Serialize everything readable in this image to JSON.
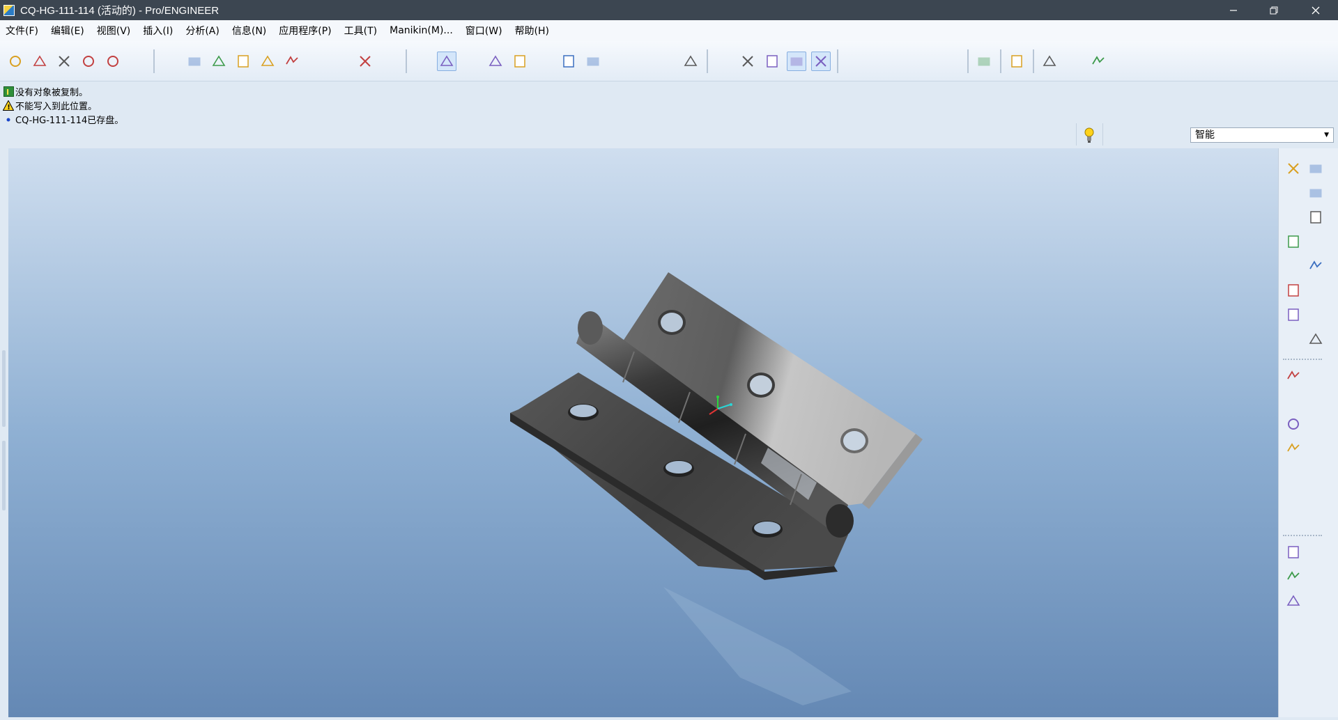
{
  "window": {
    "title": "CQ-HG-111-114 (活动的) - Pro/ENGINEER",
    "controls": [
      "minimize-icon",
      "restore-icon",
      "close-icon"
    ]
  },
  "menu": {
    "items": [
      {
        "label": "文件(F)"
      },
      {
        "label": "编辑(E)"
      },
      {
        "label": "视图(V)"
      },
      {
        "label": "插入(I)"
      },
      {
        "label": "分析(A)"
      },
      {
        "label": "信息(N)"
      },
      {
        "label": "应用程序(P)"
      },
      {
        "label": "工具(T)"
      },
      {
        "label": "Manikin(M)..."
      },
      {
        "label": "窗口(W)"
      },
      {
        "label": "帮助(H)"
      }
    ]
  },
  "toolbar": {
    "groups": [
      [
        "new-file-icon",
        "open-folder-icon",
        "save-icon",
        "print-icon",
        "send-email-icon",
        "send-link-icon"
      ],
      [
        "undo-icon",
        "redo-icon",
        "cut-icon",
        "copy-icon",
        "paste-icon",
        "paste-special-icon",
        "regenerate-icon",
        "regenerate-manager-icon",
        "find-icon",
        "select-box-icon"
      ],
      [
        "redraw-icon",
        "spin-center-icon",
        "orient-mode-icon",
        "appearance-sphere-icon",
        "pan-hand-icon",
        "zoom-in-icon",
        "zoom-out-icon",
        "refit-icon",
        "reorient-icon",
        "saved-views-icon",
        "layers-icon",
        "view-manager-icon"
      ],
      [
        "wireframe-icon",
        "hidden-line-icon",
        "no-hidden-icon",
        "shading-icon",
        "enhanced-realism-icon"
      ],
      [
        "datum-plane-display-icon",
        "datum-axis-display-icon",
        "datum-point-display-icon",
        "coordinate-system-display-icon",
        "annotation-display-icon"
      ],
      [
        "sketch-setup-icon"
      ],
      [
        "context-help-icon"
      ],
      [
        "model-player-icon",
        "simplified-rep-icon",
        "assembly-icon"
      ]
    ],
    "active": [
      "spin-center-icon",
      "shading-icon",
      "enhanced-realism-icon"
    ]
  },
  "messages": [
    {
      "icon": "info-icon",
      "text": "没有对象被复制。"
    },
    {
      "icon": "warning-icon",
      "text": "不能写入到此位置。"
    },
    {
      "icon": "bullet-icon",
      "text": "CQ-HG-111-114已存盘。"
    }
  ],
  "filter": {
    "selected": "智能"
  },
  "status_light": "yellow",
  "model": {
    "description": "hinge part"
  },
  "right_toolbar": [
    "sketch-plane-icon",
    "datum-curve-sketch-icon",
    "mirror-icon",
    "datum-plane-icon",
    "merge-icon",
    "datum-axis-icon",
    "trim-icon",
    "datum-curve-icon",
    "extend-icon",
    "datum-point-icon",
    "offset-icon",
    "datum-point-sketch-icon",
    "thicken-icon",
    "coordinate-system-icon",
    "solidify-icon",
    "analysis-feature-icon",
    "extrude-icon",
    "revolve-icon",
    "sweep-icon",
    "blend-icon",
    "rib-icon",
    "draft-icon",
    "round-icon",
    "chamfer-icon",
    "shell-icon",
    "hole-icon"
  ]
}
